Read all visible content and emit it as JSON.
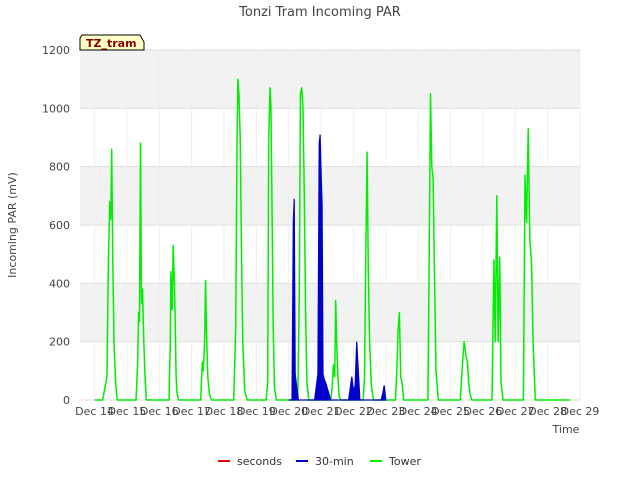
{
  "chart_data": {
    "type": "line",
    "title": "Tonzi Tram Incoming PAR",
    "xlabel": "Time",
    "ylabel": "Incoming PAR (mV)",
    "site_badge": "TZ_tram",
    "ylim": [
      0,
      1200
    ],
    "yticks": [
      0,
      200,
      400,
      600,
      800,
      1000,
      1200
    ],
    "xlim": [
      14,
      29
    ],
    "xticks": [
      {
        "value": 14,
        "label": "Dec 14"
      },
      {
        "value": 15,
        "label": "Dec 15"
      },
      {
        "value": 16,
        "label": "Dec 16"
      },
      {
        "value": 17,
        "label": "Dec 17"
      },
      {
        "value": 18,
        "label": "Dec 18"
      },
      {
        "value": 19,
        "label": "Dec 19"
      },
      {
        "value": 20,
        "label": "Dec 20"
      },
      {
        "value": 21,
        "label": "Dec 21"
      },
      {
        "value": 22,
        "label": "Dec 22"
      },
      {
        "value": 23,
        "label": "Dec 23"
      },
      {
        "value": 24,
        "label": "Dec 24"
      },
      {
        "value": 25,
        "label": "Dec 25"
      },
      {
        "value": 26,
        "label": "Dec 26"
      },
      {
        "value": 27,
        "label": "Dec 27"
      },
      {
        "value": 28,
        "label": "Dec 28"
      },
      {
        "value": 29,
        "label": "Dec 29"
      }
    ],
    "grid": true,
    "legend_position": "bottom",
    "series": [
      {
        "name": "seconds",
        "color": "#dd0000",
        "x": [],
        "y": []
      },
      {
        "name": "30-min",
        "color": "#0000cc",
        "x": [
          20.0,
          20.1,
          20.14,
          20.17,
          20.2,
          20.23,
          20.3,
          20.8,
          20.9,
          20.94,
          20.97,
          21.0,
          21.03,
          21.06,
          21.1,
          21.14,
          21.3,
          21.85,
          21.95,
          22.0,
          22.05,
          22.1,
          22.2,
          22.85,
          22.9,
          22.95,
          23.0
        ],
        "y": [
          0,
          0,
          610,
          690,
          90,
          60,
          0,
          0,
          90,
          880,
          910,
          780,
          670,
          90,
          70,
          60,
          0,
          0,
          80,
          30,
          50,
          200,
          0,
          0,
          20,
          50,
          0
        ]
      },
      {
        "name": "Tower",
        "color": "#00ee00",
        "x": [
          14.0,
          14.25,
          14.38,
          14.43,
          14.47,
          14.5,
          14.53,
          14.56,
          14.6,
          14.65,
          14.7,
          14.75,
          14.85,
          15.0,
          15.28,
          15.33,
          15.36,
          15.39,
          15.42,
          15.45,
          15.48,
          15.52,
          15.56,
          15.6,
          15.66,
          15.75,
          16.25,
          16.3,
          16.34,
          16.36,
          16.4,
          16.43,
          16.46,
          16.49,
          16.52,
          16.55,
          16.6,
          16.66,
          16.75,
          17.2,
          17.28,
          17.33,
          17.36,
          17.4,
          17.43,
          17.46,
          17.5,
          17.55,
          17.62,
          17.7,
          18.2,
          18.3,
          18.36,
          18.4,
          18.43,
          18.46,
          18.5,
          18.54,
          18.58,
          18.64,
          18.72,
          19.2,
          19.3,
          19.35,
          19.38,
          19.42,
          19.45,
          19.48,
          19.52,
          19.56,
          19.62,
          19.7,
          20.2,
          20.28,
          20.33,
          20.36,
          20.4,
          20.44,
          20.48,
          20.52,
          20.56,
          20.62,
          20.7,
          21.2,
          21.3,
          21.34,
          21.38,
          21.42,
          21.45,
          21.48,
          21.52,
          21.56,
          21.62,
          21.7,
          22.2,
          22.3,
          22.34,
          22.38,
          22.42,
          22.46,
          22.5,
          22.55,
          22.62,
          22.7,
          23.2,
          23.3,
          23.34,
          23.38,
          23.42,
          23.46,
          23.5,
          23.55,
          23.62,
          23.7,
          24.2,
          24.3,
          24.34,
          24.38,
          24.42,
          24.46,
          24.5,
          24.55,
          24.62,
          24.7,
          25.2,
          25.3,
          25.36,
          25.42,
          25.48,
          25.52,
          25.56,
          25.6,
          25.66,
          25.74,
          26.2,
          26.28,
          26.34,
          26.38,
          26.43,
          26.47,
          26.52,
          26.56,
          26.62,
          26.7,
          27.2,
          27.25,
          27.3,
          27.35,
          27.4,
          27.45,
          27.5,
          27.55,
          27.62,
          27.7,
          28.2,
          28.25,
          28.3,
          28.35,
          28.4,
          28.45,
          28.5,
          28.55,
          28.62,
          28.7,
          29.2,
          29.3,
          29.38,
          29.42,
          29.46,
          29.5,
          29.56,
          29.62,
          29.7,
          30.0
        ],
        "y": [
          0,
          0,
          80,
          500,
          680,
          620,
          860,
          500,
          200,
          60,
          0,
          0,
          0,
          0,
          0,
          120,
          300,
          270,
          880,
          330,
          380,
          200,
          80,
          0,
          0,
          0,
          0,
          0,
          200,
          440,
          310,
          530,
          420,
          290,
          80,
          20,
          0,
          0,
          0,
          0,
          0,
          130,
          100,
          200,
          410,
          230,
          80,
          20,
          0,
          0,
          0,
          0,
          250,
          880,
          1100,
          1050,
          900,
          500,
          200,
          30,
          0,
          0,
          0,
          60,
          890,
          1070,
          1010,
          700,
          250,
          40,
          0,
          0,
          0,
          0,
          400,
          1050,
          1070,
          1000,
          700,
          300,
          60,
          0,
          0,
          0,
          0,
          40,
          120,
          80,
          340,
          200,
          80,
          10,
          0,
          0,
          0,
          0,
          80,
          500,
          850,
          440,
          200,
          50,
          0,
          0,
          0,
          0,
          100,
          240,
          300,
          80,
          60,
          0,
          0,
          0,
          0,
          0,
          500,
          1050,
          800,
          760,
          440,
          100,
          0,
          0,
          0,
          0,
          110,
          200,
          150,
          130,
          60,
          20,
          0,
          0,
          0,
          0,
          480,
          200,
          700,
          200,
          490,
          60,
          0,
          0,
          0,
          0,
          770,
          610,
          930,
          550,
          470,
          200,
          0,
          0,
          0,
          0,
          0,
          0,
          0,
          0,
          0,
          0,
          0,
          0,
          0,
          0,
          0,
          0,
          0,
          0,
          0,
          0,
          0,
          0
        ]
      }
    ]
  }
}
